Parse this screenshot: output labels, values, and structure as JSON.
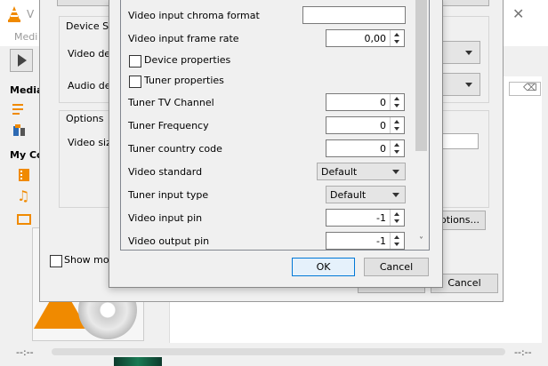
{
  "vlc": {
    "title_fragment": "V",
    "menu_media": "Medi",
    "sidebar_media": "Media",
    "sidebar_my_computer": "My Co",
    "time_left": "--:--",
    "time_right": "--:--"
  },
  "open_dialog": {
    "device_group_title": "Device Se",
    "video_device_label": "Video dev",
    "audio_device_label": "Audio dev",
    "options_group_title": "Options",
    "video_size_label": "Video size",
    "advanced_options_button": "Options...",
    "show_more_label": "Show more",
    "cancel_label": "Cancel"
  },
  "advanced": {
    "chroma_label": "Video input chroma format",
    "chroma_value": "",
    "frame_rate_label": "Video input frame rate",
    "frame_rate_value": "0,00",
    "device_properties_label": "Device properties",
    "tuner_properties_label": "Tuner properties",
    "tv_channel_label": "Tuner TV Channel",
    "tv_channel_value": "0",
    "frequency_label": "Tuner Frequency",
    "frequency_value": "0",
    "country_code_label": "Tuner country code",
    "country_code_value": "0",
    "video_standard_label": "Video standard",
    "video_standard_value": "Default",
    "input_type_label": "Tuner input type",
    "input_type_value": "Default",
    "input_pin_label": "Video input pin",
    "input_pin_value": "-1",
    "output_pin_label": "Video output pin",
    "output_pin_value": "-1",
    "ok_label": "OK",
    "cancel_label": "Cancel"
  },
  "colors": {
    "vlc_orange": "#f08a00",
    "dialog_bg": "#f0f0f0",
    "focus_blue": "#0078d7"
  },
  "icons": [
    "vlc-cone-icon",
    "close-icon",
    "play-icon",
    "playlist-icon",
    "library-icon",
    "video-icon",
    "music-icon",
    "tv-icon",
    "clear-search-icon",
    "scroll-down-icon"
  ]
}
